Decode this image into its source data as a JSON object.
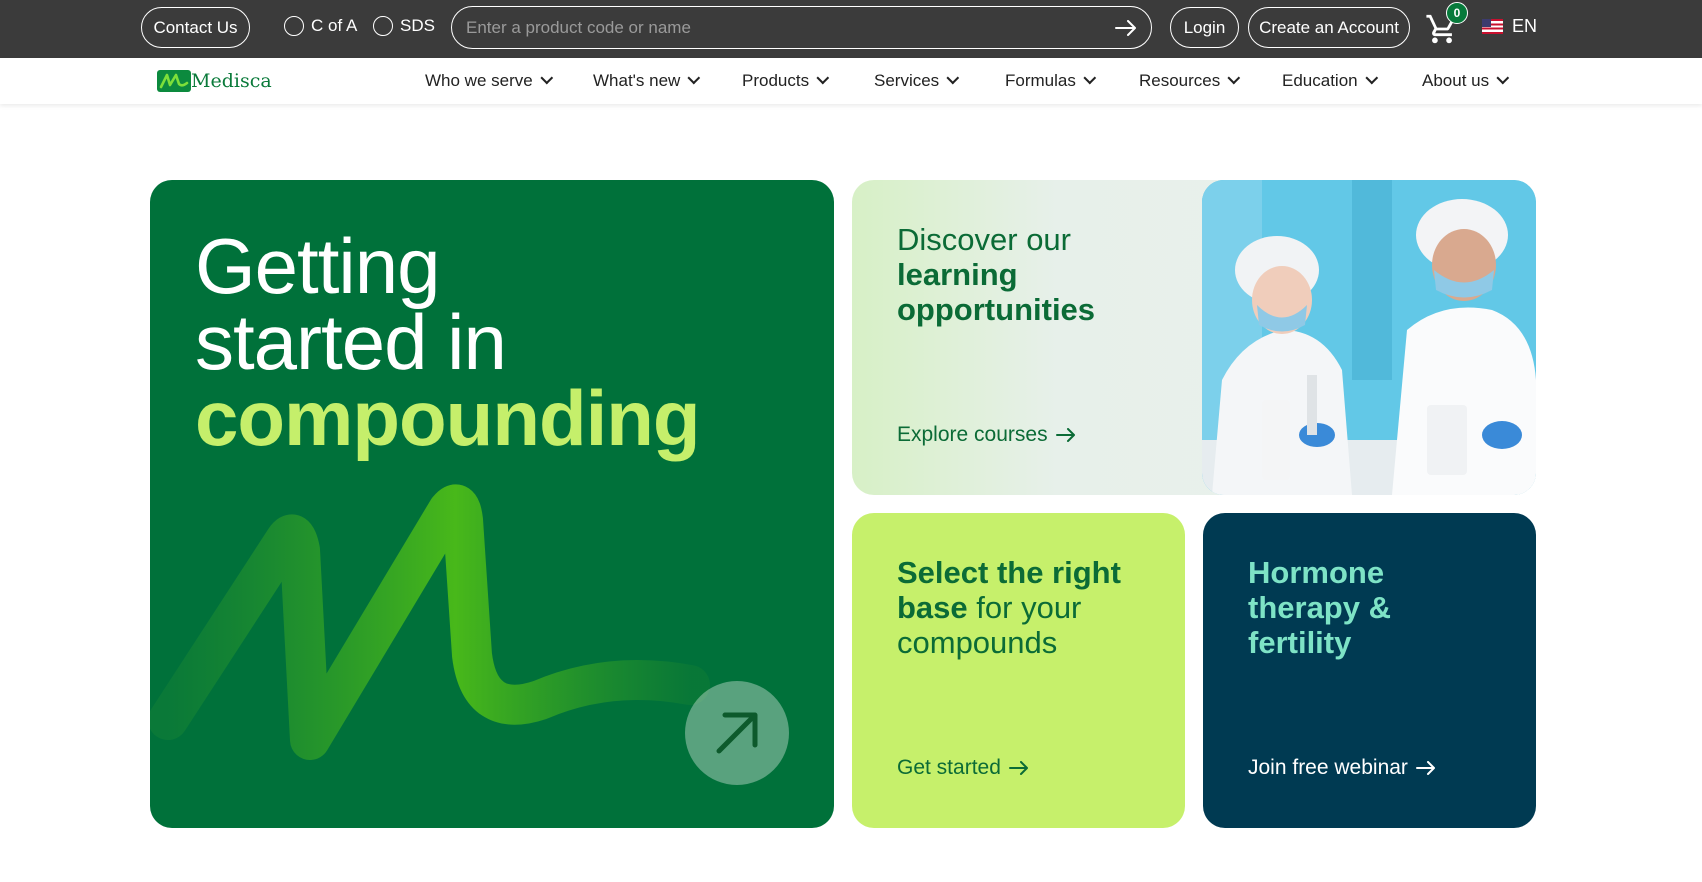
{
  "topbar": {
    "contact_label": "Contact Us",
    "radio_cofa": "C of A",
    "radio_sds": "SDS",
    "search_placeholder": "Enter a product code or name",
    "login_label": "Login",
    "create_account_label": "Create an Account",
    "cart_count": "0",
    "language": "EN"
  },
  "nav": {
    "logo_text": "Medisca",
    "items": [
      "Who we serve",
      "What's new",
      "Products",
      "Services",
      "Formulas",
      "Resources",
      "Education",
      "About us"
    ]
  },
  "hero": {
    "line1": "Getting",
    "line2": "started in",
    "line3": "compounding"
  },
  "learn": {
    "title_normal": "Discover our",
    "title_bold1": "learning",
    "title_bold2": "opportunities",
    "link": "Explore courses"
  },
  "base": {
    "title_bold1": "Select the right",
    "title_bold2": "base",
    "title_normal1": " for your",
    "title_normal2": "compounds",
    "link": "Get started"
  },
  "hormone": {
    "line1": "Hormone",
    "line2": "therapy &",
    "line3": "fertility",
    "link": "Join free webinar"
  },
  "colors": {
    "topbar_bg": "#3b3b3b",
    "brand_green": "#00713a",
    "lime": "#c6f06b",
    "navy": "#003a52",
    "mint_text": "#7ee3c6"
  }
}
